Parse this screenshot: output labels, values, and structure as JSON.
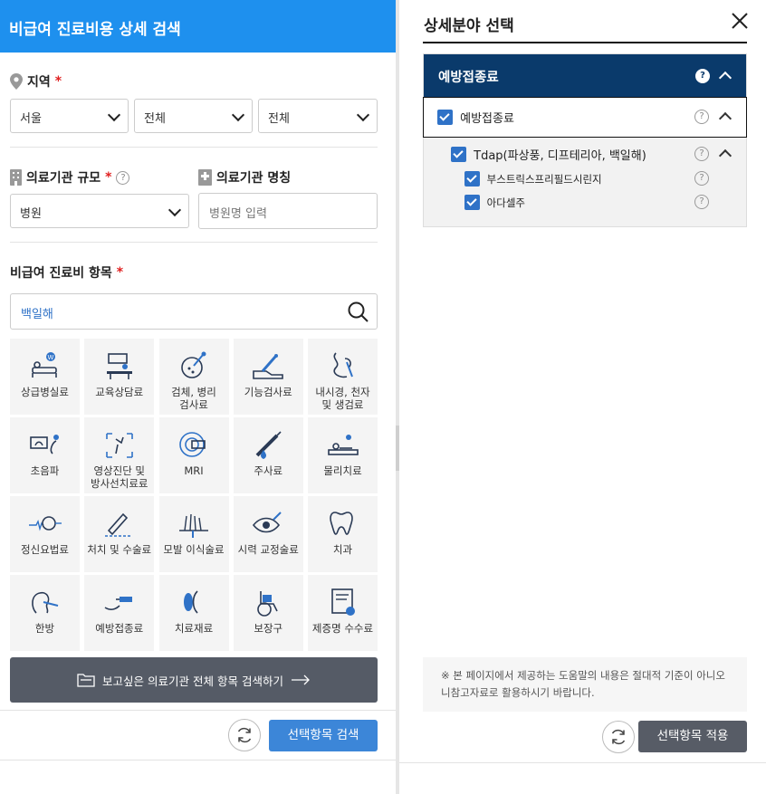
{
  "left": {
    "title": "비급여 진료비용 상세 검색",
    "region": {
      "label": "지역",
      "required": "*",
      "selects": [
        "서울",
        "전체",
        "전체"
      ]
    },
    "scale": {
      "label": "의료기관 규모",
      "required": "*",
      "help": "?",
      "value": "병원"
    },
    "name": {
      "label": "의료기관 명칭",
      "placeholder": "병원명 입력"
    },
    "items": {
      "label": "비급여 진료비 항목",
      "required": "*",
      "search_value": "백일해"
    },
    "categories": [
      {
        "label": "상급병실료",
        "icon": "hospital-bed-icon"
      },
      {
        "label": "교육상담료",
        "icon": "counseling-icon"
      },
      {
        "label": "검체, 병리\n검사료",
        "icon": "specimen-test-icon"
      },
      {
        "label": "기능검사료",
        "icon": "function-test-icon"
      },
      {
        "label": "내시경, 천자\n및 생검료",
        "icon": "endoscope-icon"
      },
      {
        "label": "초음파",
        "icon": "ultrasound-icon"
      },
      {
        "label": "영상진단 및\n방사선치료료",
        "icon": "imaging-icon"
      },
      {
        "label": "MRI",
        "icon": "mri-icon"
      },
      {
        "label": "주사료",
        "icon": "syringe-icon"
      },
      {
        "label": "물리치료",
        "icon": "physical-therapy-icon"
      },
      {
        "label": "정신요법료",
        "icon": "psychotherapy-icon"
      },
      {
        "label": "처치 및 수술료",
        "icon": "surgery-icon"
      },
      {
        "label": "모발 이식술료",
        "icon": "hair-transplant-icon"
      },
      {
        "label": "시력 교정술료",
        "icon": "vision-correction-icon"
      },
      {
        "label": "치과",
        "icon": "tooth-icon"
      },
      {
        "label": "한방",
        "icon": "acupuncture-icon"
      },
      {
        "label": "예방접종료",
        "icon": "vaccination-icon"
      },
      {
        "label": "치료재료",
        "icon": "treatment-material-icon"
      },
      {
        "label": "보장구",
        "icon": "wheelchair-icon"
      },
      {
        "label": "제증명 수수료",
        "icon": "certificate-icon"
      }
    ],
    "all_items_button": "보고싶은 의료기관 전체 항목 검색하기",
    "search_button": "선택항목 검색"
  },
  "right": {
    "title": "상세분야 선택",
    "tree": {
      "header": "예방접종료",
      "level1": "예방접종료",
      "level2": "Tdap(파상풍, 디프테리아, 백일해)",
      "level3": [
        "부스트릭스프리필드시린지",
        "아다셀주"
      ]
    },
    "notice": "※ 본 페이지에서 제공하는 도움말의 내용은 절대적 기준이 아니오니참고자료로 활용하시기 바랍니다.",
    "apply_button": "선택항목 적용"
  },
  "colors": {
    "header_blue": "#1e90ee",
    "tree_head_navy": "#0a3a6b",
    "checkbox_blue": "#2f72c7",
    "button_blue": "#3c86d8",
    "button_gray": "#575c66"
  }
}
